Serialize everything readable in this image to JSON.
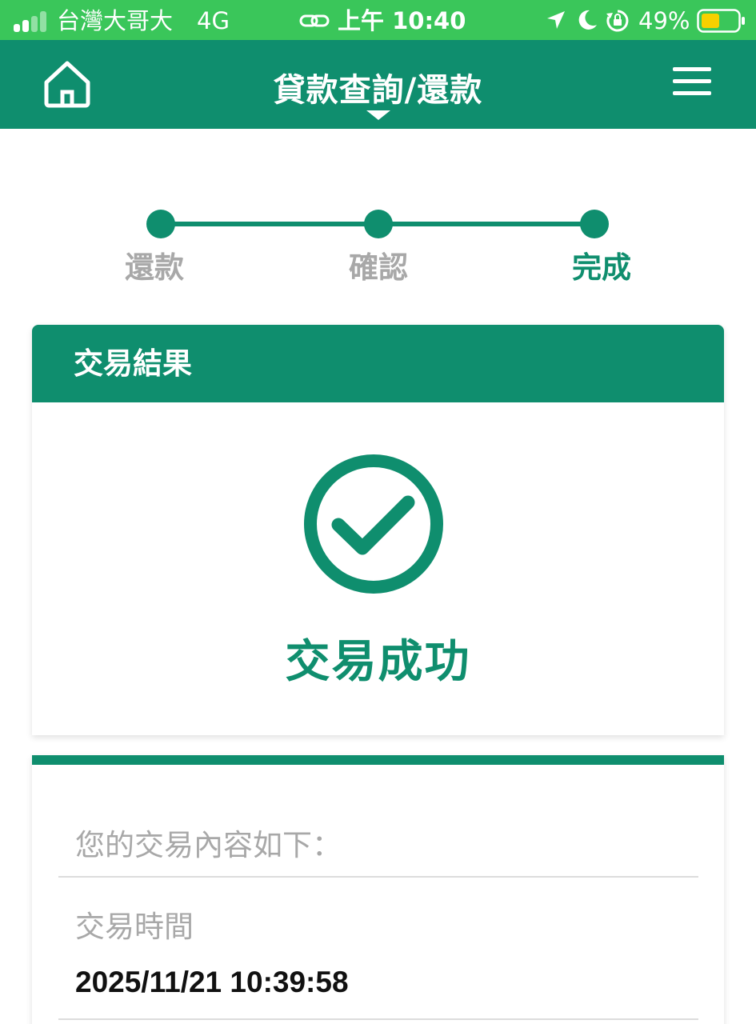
{
  "status_bar": {
    "carrier": "台灣大哥大",
    "network": "4G",
    "time": "上午 10:40",
    "battery": "49%",
    "icons": [
      "signal-icon",
      "link-icon",
      "location-arrow-icon",
      "moon-icon",
      "orientation-lock-icon",
      "battery-icon"
    ]
  },
  "header": {
    "title": "貸款查詢/還款",
    "home_icon": "home-icon",
    "menu_icon": "hamburger-menu-icon"
  },
  "stepper": {
    "steps": [
      {
        "label": "還款"
      },
      {
        "label": "確認"
      },
      {
        "label": "完成"
      }
    ],
    "current_step": 3
  },
  "result": {
    "heading": "交易結果",
    "status_icon": "check-circle-icon",
    "status_text": "交易成功"
  },
  "details": {
    "intro": "您的交易內容如下：",
    "rows": [
      {
        "label": "交易時間",
        "value": "2025/11/21 10:39:58"
      }
    ]
  },
  "colors": {
    "status_bar": "#3ac65a",
    "brand": "#0f8e6e",
    "muted_text": "#a8a8a8",
    "battery_fill": "#f7d000"
  }
}
